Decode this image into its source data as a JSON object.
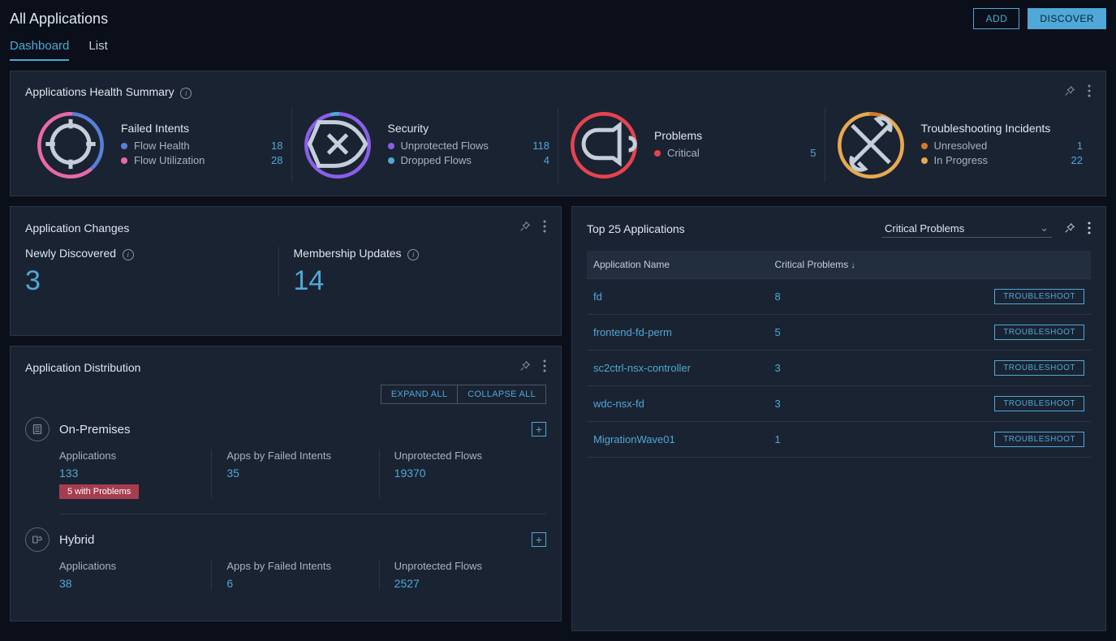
{
  "header": {
    "title": "All Applications",
    "add_label": "ADD",
    "discover_label": "DISCOVER"
  },
  "tabs": [
    {
      "label": "Dashboard",
      "active": true
    },
    {
      "label": "List",
      "active": false
    }
  ],
  "health": {
    "title": "Applications Health Summary",
    "cards": [
      {
        "label": "Failed Intents",
        "items": [
          {
            "name": "Flow Health",
            "value": "18",
            "color": "#5a7fd8"
          },
          {
            "name": "Flow Utilization",
            "value": "28",
            "color": "#e86aa6"
          }
        ]
      },
      {
        "label": "Security",
        "items": [
          {
            "name": "Unprotected Flows",
            "value": "118",
            "color": "#8a5fe8"
          },
          {
            "name": "Dropped Flows",
            "value": "4",
            "color": "#4fa8d8"
          }
        ]
      },
      {
        "label": "Problems",
        "items": [
          {
            "name": "Critical",
            "value": "5",
            "color": "#e8424f"
          }
        ]
      },
      {
        "label": "Troubleshooting Incidents",
        "items": [
          {
            "name": "Unresolved",
            "value": "1",
            "color": "#d87a2a"
          },
          {
            "name": "In Progress",
            "value": "22",
            "color": "#e8a94f"
          }
        ]
      }
    ]
  },
  "changes": {
    "title": "Application Changes",
    "cells": [
      {
        "label": "Newly Discovered",
        "value": "3"
      },
      {
        "label": "Membership Updates",
        "value": "14"
      }
    ]
  },
  "distribution": {
    "title": "Application Distribution",
    "expand_all": "EXPAND ALL",
    "collapse_all": "COLLAPSE ALL",
    "sections": [
      {
        "name": "On-Premises",
        "metrics": [
          {
            "label": "Applications",
            "value": "133",
            "badge": "5 with Problems"
          },
          {
            "label": "Apps by Failed Intents",
            "value": "35"
          },
          {
            "label": "Unprotected Flows",
            "value": "19370"
          }
        ]
      },
      {
        "name": "Hybrid",
        "metrics": [
          {
            "label": "Applications",
            "value": "38"
          },
          {
            "label": "Apps by Failed Intents",
            "value": "6"
          },
          {
            "label": "Unprotected Flows",
            "value": "2527"
          }
        ]
      }
    ]
  },
  "top25": {
    "title": "Top 25 Applications",
    "filter": "Critical Problems",
    "columns": {
      "name": "Application Name",
      "problems": "Critical Problems"
    },
    "troubleshoot_label": "TROUBLESHOOT",
    "rows": [
      {
        "name": "fd",
        "value": "8"
      },
      {
        "name": "frontend-fd-perm",
        "value": "5"
      },
      {
        "name": "sc2ctrl-nsx-controller",
        "value": "3"
      },
      {
        "name": "wdc-nsx-fd",
        "value": "3"
      },
      {
        "name": "MigrationWave01",
        "value": "1"
      }
    ]
  }
}
